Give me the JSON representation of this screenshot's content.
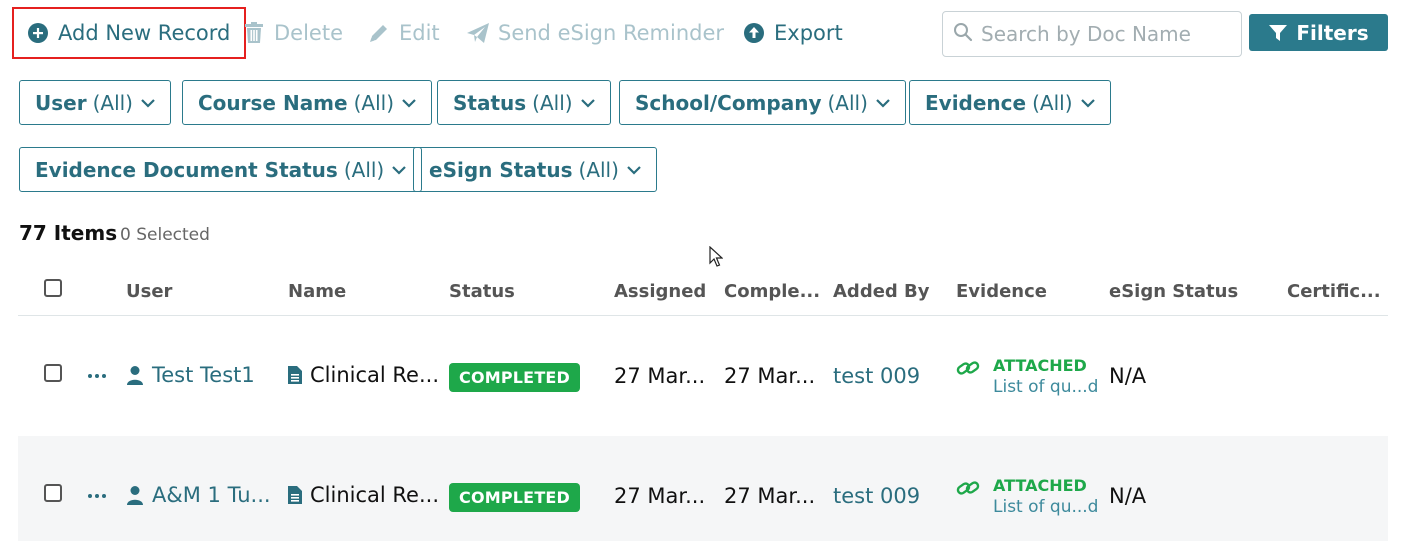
{
  "toolbar": {
    "add_label": "Add New Record",
    "delete_label": "Delete",
    "edit_label": "Edit",
    "remind_label": "Send eSign Reminder",
    "export_label": "Export"
  },
  "search": {
    "placeholder": "Search by Doc Name"
  },
  "filters_label": "Filters",
  "filter_chips": [
    {
      "label": "User",
      "value": "(All)"
    },
    {
      "label": "Course Name",
      "value": "(All)"
    },
    {
      "label": "Status",
      "value": "(All)"
    },
    {
      "label": "School/Company",
      "value": "(All)"
    },
    {
      "label": "Evidence",
      "value": "(All)"
    },
    {
      "label": "Evidence Document Status",
      "value": "(All)"
    },
    {
      "label": "eSign Status",
      "value": "(All)"
    }
  ],
  "summary": {
    "items": "77 Items",
    "selected": "0 Selected"
  },
  "columns": [
    "User",
    "Name",
    "Status",
    "Assigned",
    "Comple...",
    "Added By",
    "Evidence",
    "eSign Status",
    "Certific..."
  ],
  "rows": [
    {
      "user": "Test Test1",
      "name": "Clinical Re...",
      "status": "COMPLETED",
      "assigned": "27 Mar...",
      "completed": "27 Mar...",
      "added_by": "test 009",
      "evidence_status": "ATTACHED",
      "evidence_file": "List of qu...d",
      "esign": "N/A"
    },
    {
      "user": "A&M 1 Tu...",
      "name": "Clinical Re...",
      "status": "COMPLETED",
      "assigned": "27 Mar...",
      "completed": "27 Mar...",
      "added_by": "test 009",
      "evidence_status": "ATTACHED",
      "evidence_file": "List of qu...d",
      "esign": "N/A"
    }
  ],
  "colors": {
    "accent": "#2b7a8c",
    "success": "#1ea84a",
    "highlight": "#e5201f"
  }
}
